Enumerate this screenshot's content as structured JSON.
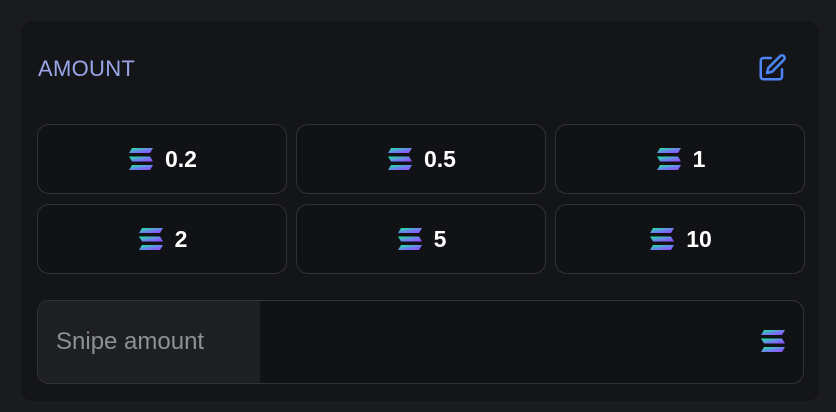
{
  "section": {
    "title": "AMOUNT",
    "edit_icon": "edit-icon"
  },
  "currency_icon": "solana-icon",
  "preset_amounts": [
    "0.2",
    "0.5",
    "1",
    "2",
    "5",
    "10"
  ],
  "input": {
    "label": "Snipe amount",
    "value": ""
  },
  "colors": {
    "accent": "#4f86f7",
    "title": "#9aa5e8",
    "solana_gradient": [
      "#14f195",
      "#9945ff"
    ]
  }
}
